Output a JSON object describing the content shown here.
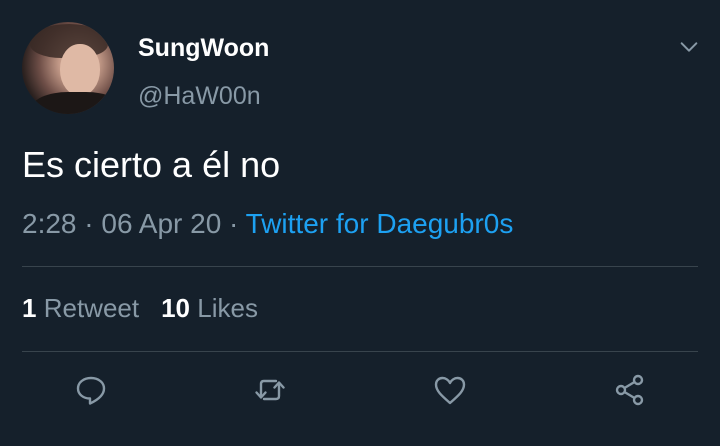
{
  "author": {
    "name": "SungWoon",
    "handle": "@HaW00n"
  },
  "tweet": {
    "text": "Es cierto a él no",
    "time": "2:28",
    "separator": "·",
    "date": "06 Apr 20",
    "source": "Twitter for Daegubr0s"
  },
  "stats": {
    "retweets_count": "1",
    "retweets_label": "Retweet",
    "likes_count": "10",
    "likes_label": "Likes"
  },
  "icons": {
    "more": "chevron-down-icon",
    "reply": "reply-icon",
    "retweet": "retweet-icon",
    "like": "heart-icon",
    "share": "share-icon"
  },
  "colors": {
    "background": "#15202b",
    "secondary_text": "#8899a6",
    "link": "#1da1f2",
    "divider": "#38444d"
  }
}
